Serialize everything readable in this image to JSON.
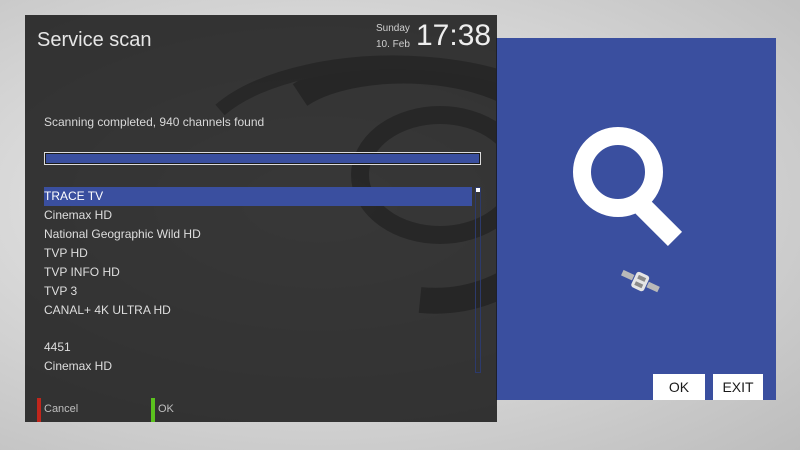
{
  "window": {
    "title": "Service scan"
  },
  "datetime": {
    "day": "Sunday",
    "date": "10. Feb",
    "time": "17:38"
  },
  "scan": {
    "status": "Scanning completed, 940 channels found",
    "progress": 1.0
  },
  "channels": [
    "TRACE TV",
    "Cinemax HD",
    "National Geographic Wild HD",
    "TVP HD",
    "TVP INFO HD",
    "TVP 3",
    "CANAL+ 4K ULTRA HD",
    "",
    "4451",
    "Cinemax HD"
  ],
  "footer": {
    "cancel_label": "Cancel",
    "ok_label": "OK"
  },
  "right_panel": {
    "ok_label": "OK",
    "exit_label": "EXIT"
  },
  "colors": {
    "accent": "#3a4f9f",
    "red_key": "#c0261c",
    "green_key": "#5bc21e"
  },
  "icons": {
    "search": "search-icon",
    "satellite": "satellite-icon"
  }
}
